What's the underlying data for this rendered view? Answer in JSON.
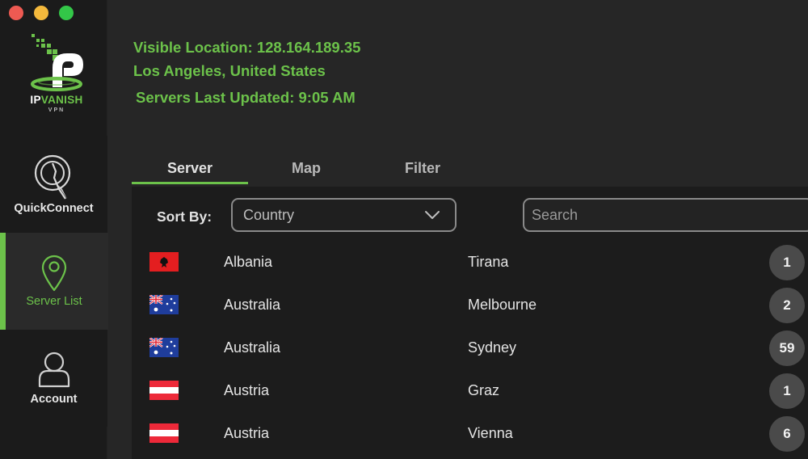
{
  "window": {
    "controls": [
      "close",
      "minimize",
      "maximize"
    ]
  },
  "brand": {
    "logo_ip": "IP",
    "logo_vanish": "VANISH",
    "logo_sub": "VPN",
    "accent_color": "#6cc24a"
  },
  "sidebar": {
    "items": [
      {
        "id": "quickconnect",
        "label": "QuickConnect",
        "icon": "quickconnect-icon",
        "active": false
      },
      {
        "id": "server-list",
        "label": "Server List",
        "icon": "location-pin-icon",
        "active": true
      },
      {
        "id": "account",
        "label": "Account",
        "icon": "user-icon",
        "active": false
      }
    ]
  },
  "status": {
    "visible_location": "Visible Location: 128.164.189.35",
    "city_country": "Los Angeles, United States",
    "servers_updated": "Servers Last Updated: 9:05 AM"
  },
  "tabs": [
    {
      "label": "Server",
      "active": true
    },
    {
      "label": "Map",
      "active": false
    },
    {
      "label": "Filter",
      "active": false
    }
  ],
  "controls": {
    "sort_label": "Sort By:",
    "sort_value": "Country",
    "search_placeholder": "Search",
    "search_value": ""
  },
  "servers": [
    {
      "flag": "albania",
      "country": "Albania",
      "city": "Tirana",
      "count": "1"
    },
    {
      "flag": "australia",
      "country": "Australia",
      "city": "Melbourne",
      "count": "2"
    },
    {
      "flag": "australia",
      "country": "Australia",
      "city": "Sydney",
      "count": "59"
    },
    {
      "flag": "austria",
      "country": "Austria",
      "city": "Graz",
      "count": "1"
    },
    {
      "flag": "austria",
      "country": "Austria",
      "city": "Vienna",
      "count": "6"
    }
  ]
}
